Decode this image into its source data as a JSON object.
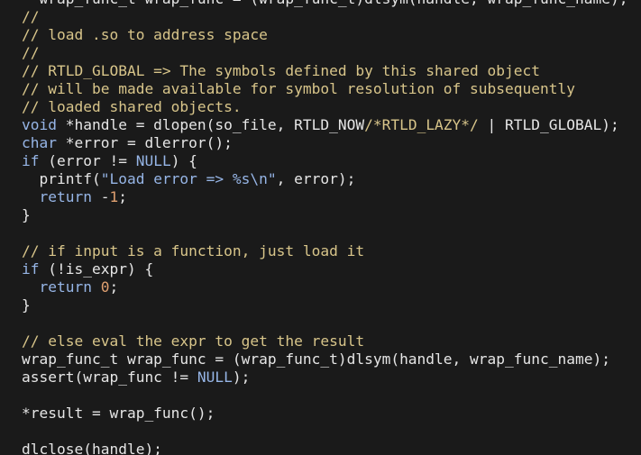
{
  "editor": {
    "lines": [
      {
        "tokens": [
          {
            "t": "  wrap_func_t wrap_func = (wrap_func_t)dlsym(handle, wrap_func_name);",
            "c": "plain"
          }
        ]
      },
      {
        "tokens": [
          {
            "t": "//",
            "c": "comment"
          }
        ]
      },
      {
        "tokens": [
          {
            "t": "// load .so to address space",
            "c": "comment"
          }
        ]
      },
      {
        "tokens": [
          {
            "t": "//",
            "c": "comment"
          }
        ]
      },
      {
        "tokens": [
          {
            "t": "// RTLD_GLOBAL => The symbols defined by this shared object",
            "c": "comment"
          }
        ]
      },
      {
        "tokens": [
          {
            "t": "// will be made available for symbol resolution of subsequently",
            "c": "comment"
          }
        ]
      },
      {
        "tokens": [
          {
            "t": "// loaded shared objects.",
            "c": "comment"
          }
        ]
      },
      {
        "tokens": [
          {
            "t": "void",
            "c": "keyword"
          },
          {
            "t": " *handle = dlopen(so_file, RTLD_NOW",
            "c": "plain"
          },
          {
            "t": "/*RTLD_LAZY*/",
            "c": "comment"
          },
          {
            "t": " | RTLD_GLOBAL);",
            "c": "plain"
          }
        ]
      },
      {
        "tokens": [
          {
            "t": "char",
            "c": "keyword"
          },
          {
            "t": " *error = dlerror();",
            "c": "plain"
          }
        ]
      },
      {
        "tokens": [
          {
            "t": "if",
            "c": "keyword"
          },
          {
            "t": " (error != ",
            "c": "plain"
          },
          {
            "t": "NULL",
            "c": "keyword"
          },
          {
            "t": ") {",
            "c": "plain"
          }
        ]
      },
      {
        "tokens": [
          {
            "t": "  printf(",
            "c": "plain"
          },
          {
            "t": "\"Load error => %s\\n\"",
            "c": "string"
          },
          {
            "t": ", error);",
            "c": "plain"
          }
        ]
      },
      {
        "tokens": [
          {
            "t": "  ",
            "c": "plain"
          },
          {
            "t": "return",
            "c": "keyword"
          },
          {
            "t": " -",
            "c": "plain"
          },
          {
            "t": "1",
            "c": "number"
          },
          {
            "t": ";",
            "c": "plain"
          }
        ]
      },
      {
        "tokens": [
          {
            "t": "}",
            "c": "plain"
          }
        ]
      },
      {
        "tokens": [
          {
            "t": "",
            "c": "plain"
          }
        ]
      },
      {
        "tokens": [
          {
            "t": "// if input is a function, just load it",
            "c": "comment"
          }
        ]
      },
      {
        "tokens": [
          {
            "t": "if",
            "c": "keyword"
          },
          {
            "t": " (!is_expr) {",
            "c": "plain"
          }
        ]
      },
      {
        "tokens": [
          {
            "t": "  ",
            "c": "plain"
          },
          {
            "t": "return",
            "c": "keyword"
          },
          {
            "t": " ",
            "c": "plain"
          },
          {
            "t": "0",
            "c": "number"
          },
          {
            "t": ";",
            "c": "plain"
          }
        ]
      },
      {
        "tokens": [
          {
            "t": "}",
            "c": "plain"
          }
        ]
      },
      {
        "tokens": [
          {
            "t": "",
            "c": "plain"
          }
        ]
      },
      {
        "tokens": [
          {
            "t": "// else eval the expr to get the result",
            "c": "comment"
          }
        ]
      },
      {
        "tokens": [
          {
            "t": "wrap_func_t wrap_func = (wrap_func_t)dlsym(handle, wrap_func_name);",
            "c": "plain"
          }
        ]
      },
      {
        "tokens": [
          {
            "t": "assert(wrap_func != ",
            "c": "plain"
          },
          {
            "t": "NULL",
            "c": "keyword"
          },
          {
            "t": ");",
            "c": "plain"
          }
        ]
      },
      {
        "tokens": [
          {
            "t": "",
            "c": "plain"
          }
        ]
      },
      {
        "tokens": [
          {
            "t": "*result = wrap_func();",
            "c": "plain"
          }
        ]
      },
      {
        "tokens": [
          {
            "t": "",
            "c": "plain"
          }
        ]
      },
      {
        "tokens": [
          {
            "t": "dlclose(handle);",
            "c": "plain"
          }
        ]
      }
    ]
  },
  "colors": {
    "background": "#1a1a1a",
    "plain": "#e6e6e6",
    "comment": "#d8c58a",
    "keyword": "#96b5e6",
    "string": "#96b5e6",
    "number": "#e0a070"
  }
}
